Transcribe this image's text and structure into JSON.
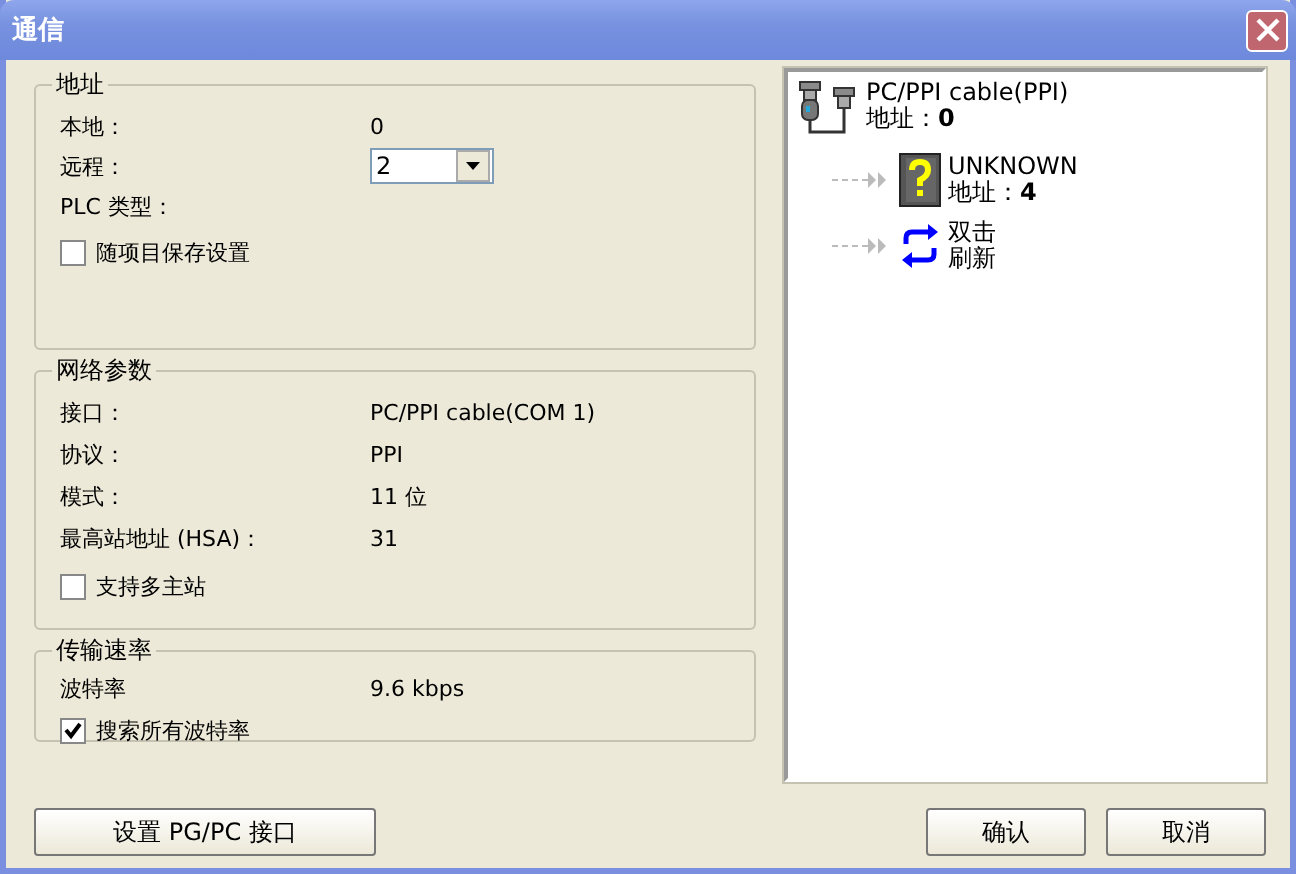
{
  "window": {
    "title": "通信"
  },
  "address": {
    "title": "地址",
    "rows": [
      {
        "kind": "text",
        "label": "本地：",
        "value": "0"
      },
      {
        "kind": "dropdown",
        "label": "远程：",
        "value": "2"
      },
      {
        "kind": "text",
        "label": "PLC 类型："
      }
    ],
    "checkbox": {
      "label": "随项目保存设置",
      "checked": false
    }
  },
  "network": {
    "title": "网络参数",
    "rows": [
      {
        "kind": "text",
        "label": "接口：",
        "value": "PC/PPI cable(COM 1)"
      },
      {
        "kind": "text",
        "label": "协议：",
        "value": "PPI"
      },
      {
        "kind": "text",
        "label": "模式：",
        "value": "11 位"
      },
      {
        "kind": "text",
        "label": "最高站地址 (HSA)：",
        "value": "31"
      }
    ],
    "checkbox": {
      "label": "支持多主站",
      "checked": false
    }
  },
  "rate": {
    "title": "传输速率",
    "rows": [
      {
        "kind": "text",
        "label": "波特率",
        "value": "9.6 kbps"
      }
    ],
    "checkbox": {
      "label": "搜索所有波特率",
      "checked": true
    }
  },
  "tree": {
    "kind": "cable",
    "label": "PC/PPI cable(PPI)",
    "sublabel": "地址：**0**",
    "children": [
      {
        "kind": "unknown",
        "label": "UNKNOWN",
        "sublabel": "地址：**4**"
      },
      {
        "kind": "refresh",
        "label": "双击",
        "sublabel": "刷新"
      }
    ]
  },
  "buttons": {
    "left": "设置 PG/PC 接口",
    "ok": "确认",
    "cancel": "取消"
  }
}
